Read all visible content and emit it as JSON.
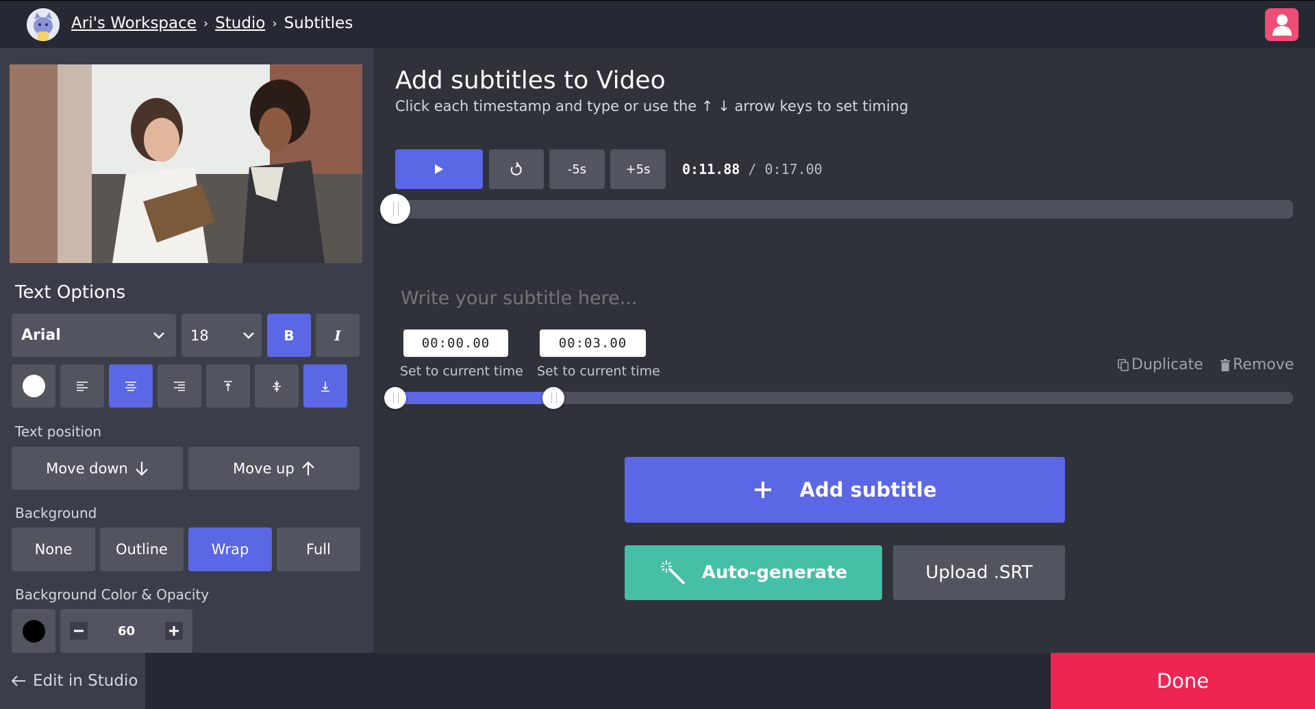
{
  "breadcrumb": {
    "workspace": "Ari's Workspace",
    "studio": "Studio",
    "current": "Subtitles"
  },
  "text_options": {
    "title": "Text Options",
    "font": "Arial",
    "size": "18",
    "bold_label": "B",
    "italic_label": "I",
    "text_color": "#ffffff"
  },
  "text_position": {
    "label": "Text position",
    "move_down": "Move down",
    "move_up": "Move up"
  },
  "background": {
    "label": "Background",
    "options": [
      "None",
      "Outline",
      "Wrap",
      "Full"
    ],
    "selected": "Wrap"
  },
  "bg_color": {
    "label": "Background Color & Opacity",
    "color": "#000000",
    "opacity": "60"
  },
  "main": {
    "title": "Add subtitles to Video",
    "subtitle": "Click each timestamp and type or use the ↑ ↓ arrow keys to set timing"
  },
  "playback": {
    "minus_label": "-5s",
    "plus_label": "+5s",
    "current_time": "0:11.88",
    "separator": "/",
    "total_time": "0:17.00",
    "progress": 0.0
  },
  "subtitle_entry": {
    "placeholder": "Write your subtitle here...",
    "start": "00:00.00",
    "end": "00:03.00",
    "set_current": "Set to current time",
    "duplicate": "Duplicate",
    "remove": "Remove",
    "range_start_fraction": 0.0,
    "range_end_fraction": 0.176
  },
  "actions": {
    "add_subtitle": "Add subtitle",
    "auto_generate": "Auto-generate",
    "upload_srt": "Upload .SRT"
  },
  "footer": {
    "edit_in_studio": "Edit in Studio",
    "done": "Done"
  },
  "colors": {
    "accent": "#5b67e4",
    "done": "#ef2452",
    "auto": "#45bfa5",
    "user": "#ee4d74"
  }
}
